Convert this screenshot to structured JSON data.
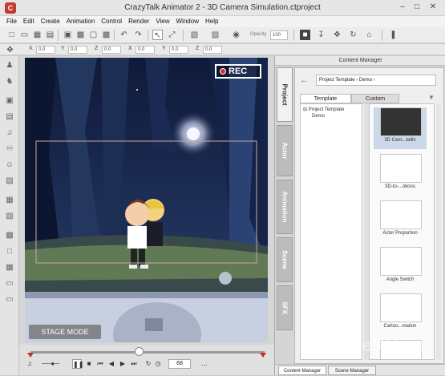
{
  "app": {
    "title": "CrazyTalk Animator 2  -  3D Camera Simulation.ctproject",
    "icon": "app-logo-icon"
  },
  "menu": [
    "File",
    "Edit",
    "Create",
    "Animation",
    "Control",
    "Render",
    "View",
    "Window",
    "Help"
  ],
  "toolbar": {
    "opacity_label": "Opacity",
    "opacity_value": "100"
  },
  "coords": [
    {
      "label": "X",
      "value": "0.0"
    },
    {
      "label": "Y",
      "value": "0.0"
    },
    {
      "label": "Z",
      "value": "0.0"
    },
    {
      "label": "X",
      "value": "0.0"
    },
    {
      "label": "Y",
      "value": "0.0"
    },
    {
      "label": "Z",
      "value": "0.0"
    }
  ],
  "stage": {
    "rec_label": "REC",
    "mode_label": "STAGE MODE"
  },
  "timeline": {
    "frame": "68"
  },
  "content_manager": {
    "header": "Content Manager",
    "breadcrumb": "Project Template › Demo ›",
    "tabs": [
      "Template",
      "Custom"
    ],
    "vertical_tabs": [
      "Project",
      "Actor",
      "Animation",
      "Scene",
      "SFX"
    ],
    "tree": [
      "Project Template",
      "Demo"
    ],
    "thumbnails": [
      "3D Cam...tallin",
      "3D-to-...otions",
      "Actor Proportion",
      "Angle Switch",
      "Cartoo...mation"
    ],
    "bottom_tabs": [
      "Content Manager",
      "Scene Manager"
    ]
  },
  "watermark": "GeeKK.ru",
  "colors": {
    "rec_dot": "#e2262c",
    "timeline_marker": "#c52d2d",
    "night_sky": "#1b2a52"
  }
}
